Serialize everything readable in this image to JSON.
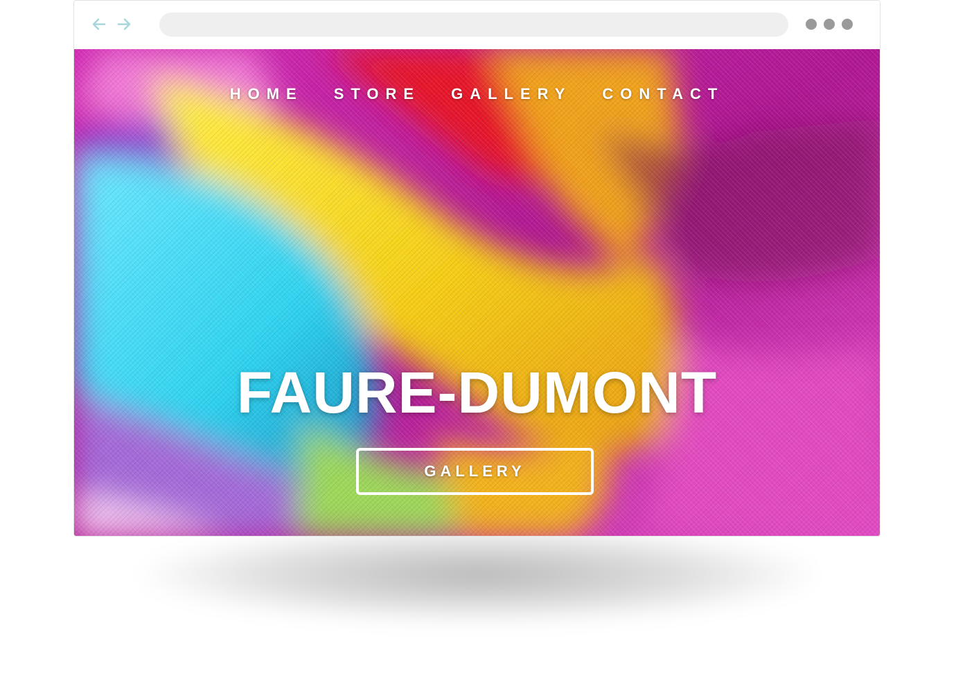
{
  "browser": {
    "back_icon": "arrow-left-icon",
    "forward_icon": "arrow-right-icon",
    "menu_icon": "more-dots-icon",
    "arrow_color": "#a8d6da",
    "dot_color": "#9a9a9a"
  },
  "site": {
    "nav": [
      {
        "label": "HOME"
      },
      {
        "label": "STORE"
      },
      {
        "label": "GALLERY"
      },
      {
        "label": "CONTACT"
      }
    ],
    "hero_title": "FAURE-DUMONT",
    "cta_label": "GALLERY"
  },
  "colors": {
    "cyan": "#2fd3f0",
    "yellow": "#f7e31c",
    "orange": "#f0a21a",
    "red": "#e6152a",
    "magenta": "#c51c9e",
    "purple": "#8a3fd1",
    "pink": "#f07ad6"
  }
}
